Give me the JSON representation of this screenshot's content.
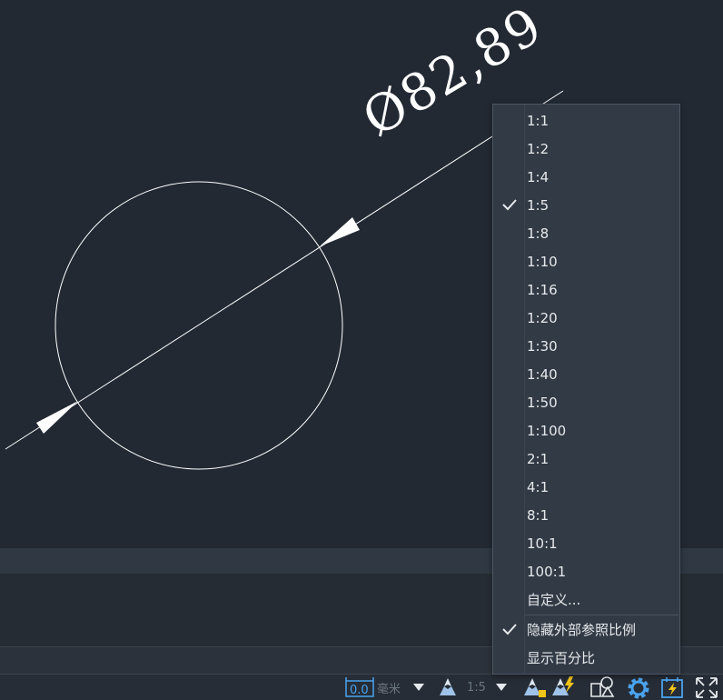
{
  "drawing": {
    "dimension_text": "Ø82,89"
  },
  "scale_menu": {
    "items": [
      {
        "label": "1:1",
        "checked": false
      },
      {
        "label": "1:2",
        "checked": false
      },
      {
        "label": "1:4",
        "checked": false
      },
      {
        "label": "1:5",
        "checked": true
      },
      {
        "label": "1:8",
        "checked": false
      },
      {
        "label": "1:10",
        "checked": false
      },
      {
        "label": "1:16",
        "checked": false
      },
      {
        "label": "1:20",
        "checked": false
      },
      {
        "label": "1:30",
        "checked": false
      },
      {
        "label": "1:40",
        "checked": false
      },
      {
        "label": "1:50",
        "checked": false
      },
      {
        "label": "1:100",
        "checked": false
      },
      {
        "label": "2:1",
        "checked": false
      },
      {
        "label": "4:1",
        "checked": false
      },
      {
        "label": "8:1",
        "checked": false
      },
      {
        "label": "10:1",
        "checked": false
      },
      {
        "label": "100:1",
        "checked": false
      },
      {
        "label": "自定义...",
        "checked": false
      }
    ],
    "options": [
      {
        "label": "隐藏外部参照比例",
        "checked": true
      },
      {
        "label": "显示百分比",
        "checked": false
      }
    ]
  },
  "statusbar": {
    "units_label": "毫米",
    "scale_label": "1:5",
    "icons": [
      "units-icon",
      "annotation-scale-icon",
      "annotation-visibility-icon",
      "auto-scale-icon",
      "workspace-icon",
      "settings-gear-icon",
      "hardware-acceleration-icon",
      "fullscreen-icon"
    ]
  },
  "colors": {
    "canvas": "#222933",
    "menu_bg": "#323a45",
    "icon_blue": "#4aa3ef",
    "icon_yellow": "#f0c419"
  }
}
